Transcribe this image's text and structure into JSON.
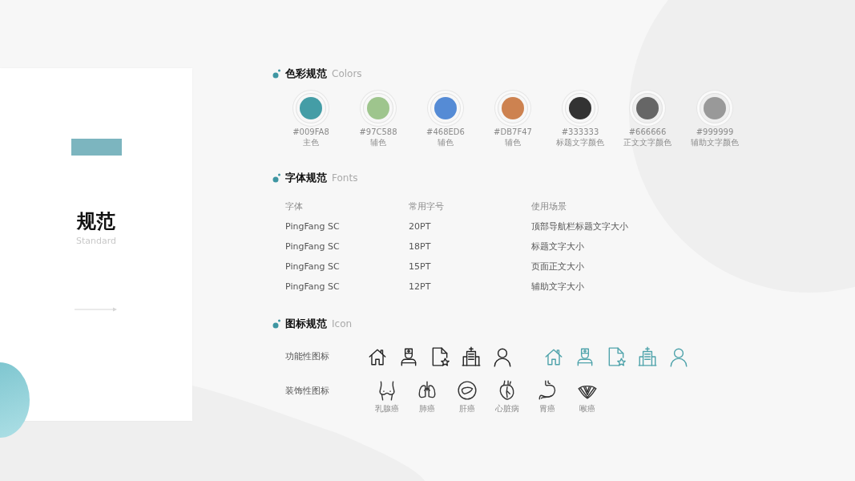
{
  "cover": {
    "title": "规范",
    "subtitle": "Standard"
  },
  "sections": [
    {
      "title": "色彩规范",
      "subtitle": "Colors"
    },
    {
      "title": "字体规范",
      "subtitle": "Fonts"
    },
    {
      "title": "图标规范",
      "subtitle": "Icon"
    }
  ],
  "colors": [
    {
      "color": "#449da6",
      "code": "#009FA8",
      "usage": "主色"
    },
    {
      "color": "#9ec58d",
      "code": "#97C588",
      "usage": "辅色"
    },
    {
      "color": "#558bd5",
      "code": "#468ED6",
      "usage": "辅色"
    },
    {
      "color": "#cd8250",
      "code": "#DB7F47",
      "usage": "辅色"
    },
    {
      "color": "#333333",
      "code": "#333333",
      "usage": "标题文字颜色"
    },
    {
      "color": "#666666",
      "code": "#666666",
      "usage": "正文文字颜色"
    },
    {
      "color": "#999999",
      "code": "#999999",
      "usage": "辅助文字颜色"
    }
  ],
  "fonts_table": {
    "columns": [
      "字体",
      "常用字号",
      "使用场景"
    ],
    "rows": [
      [
        "PingFang SC",
        "20PT",
        "顶部导航栏标题文字大小"
      ],
      [
        "PingFang SC",
        "18PT",
        "标题文字大小"
      ],
      [
        "PingFang SC",
        "15PT",
        "页面正文大小"
      ],
      [
        "PingFang SC",
        "12PT",
        "辅助文字大小"
      ]
    ]
  },
  "functional_icons": {
    "label": "功能性图标",
    "sets": [
      {
        "color": "#222222",
        "icons": [
          {
            "kind": "house"
          },
          {
            "kind": "nurse"
          },
          {
            "kind": "document"
          },
          {
            "kind": "hospital"
          },
          {
            "kind": "person"
          }
        ]
      },
      {
        "color": "#4fa3ab",
        "icons": [
          {
            "kind": "house"
          },
          {
            "kind": "nurse"
          },
          {
            "kind": "document"
          },
          {
            "kind": "hospital"
          },
          {
            "kind": "person"
          }
        ]
      }
    ]
  },
  "decorative_icons": {
    "label": "装饰性图标",
    "icons": [
      {
        "kind": "breast",
        "caption": "乳腺癌"
      },
      {
        "kind": "lungs",
        "caption": "肺癌"
      },
      {
        "kind": "liver",
        "caption": "肝癌"
      },
      {
        "kind": "heart",
        "caption": "心脏病"
      },
      {
        "kind": "stomach",
        "caption": "胃癌"
      },
      {
        "kind": "throat",
        "caption": "喉癌"
      }
    ]
  }
}
